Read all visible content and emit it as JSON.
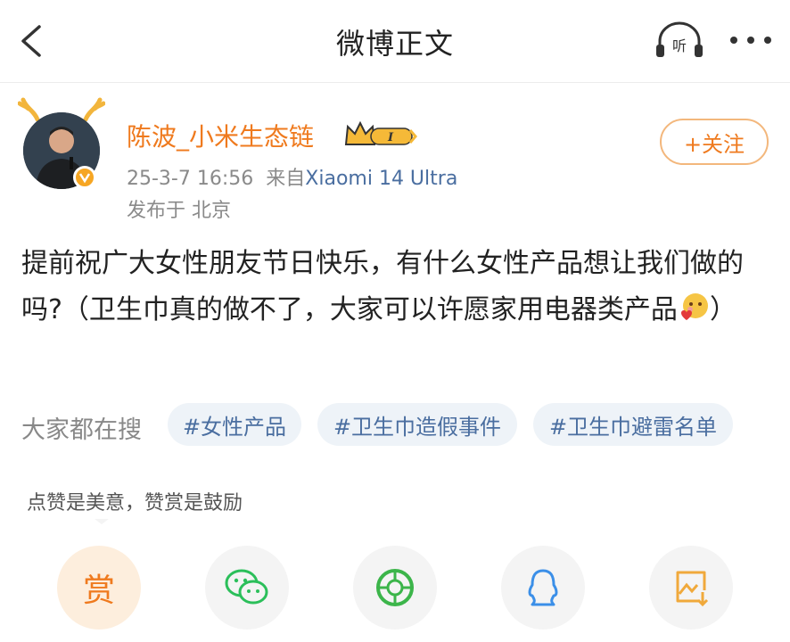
{
  "header": {
    "title": "微博正文"
  },
  "author": {
    "name": "陈波_小米生态链",
    "timestamp": "25-3-7 16:56",
    "source_prefix": "来自",
    "source_device": "Xiaomi 14 Ultra",
    "location_label": "发布于 北京",
    "follow_label": "+关注"
  },
  "post": {
    "text_before_emoji": "提前祝广大女性朋友节日快乐，有什么女性产品想让我们做的吗?（卫生巾真的做不了，大家可以许愿家用电器类产品",
    "text_after_emoji": "）"
  },
  "search": {
    "label": "大家都在搜",
    "tags": [
      "#女性产品",
      "#卫生巾造假事件",
      "#卫生巾避雷名单"
    ]
  },
  "reward": {
    "tip": "点赞是美意，赞赏是鼓励",
    "button_label": "赏"
  },
  "colors": {
    "accent": "#ef7a1e",
    "link": "#4a6ea0",
    "wechat": "#2bbf5a",
    "moments": "#3cb54a",
    "qq": "#3b8fe8",
    "save": "#f0a93b"
  },
  "icons": [
    "back-arrow-icon",
    "headphone-listen-icon",
    "more-icon",
    "wechat-icon",
    "moments-icon",
    "qq-icon",
    "save-image-icon"
  ]
}
